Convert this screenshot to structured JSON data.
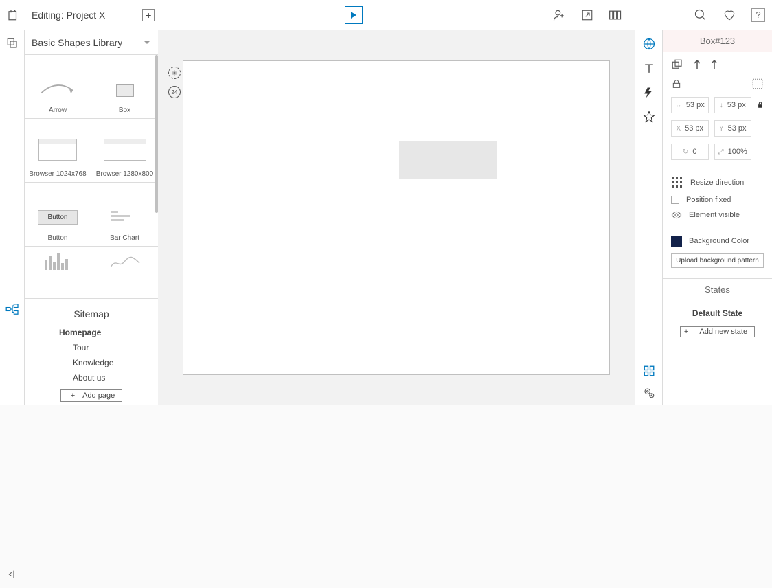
{
  "header": {
    "title": "Editing: Project X"
  },
  "library": {
    "title": "Basic Shapes Library",
    "items": [
      {
        "label": "Arrow"
      },
      {
        "label": "Box"
      },
      {
        "label": "Browser 1024x768"
      },
      {
        "label": "Browser 1280x800"
      },
      {
        "label": "Button",
        "button_text": "Button"
      },
      {
        "label": "Bar Chart"
      }
    ]
  },
  "sitemap": {
    "title": "Sitemap",
    "root": "Homepage",
    "children": [
      "Tour",
      "Knowledge",
      "About us"
    ],
    "add_label": "Add page"
  },
  "inspector": {
    "title": "Box#123",
    "width": "53 px",
    "height": "53 px",
    "x": "53 px",
    "y": "53 px",
    "x_label": "X",
    "y_label": "Y",
    "rotation": "0",
    "zoom": "100%",
    "resize_label": "Resize direction",
    "position_fixed_label": "Position fixed",
    "element_visible_label": "Element visible",
    "bg_color_label": "Background Color",
    "upload_label": "Upload background pattern"
  },
  "states": {
    "title": "States",
    "default": "Default State",
    "add_label": "Add new state"
  },
  "canvas": {
    "history_count": "24"
  }
}
